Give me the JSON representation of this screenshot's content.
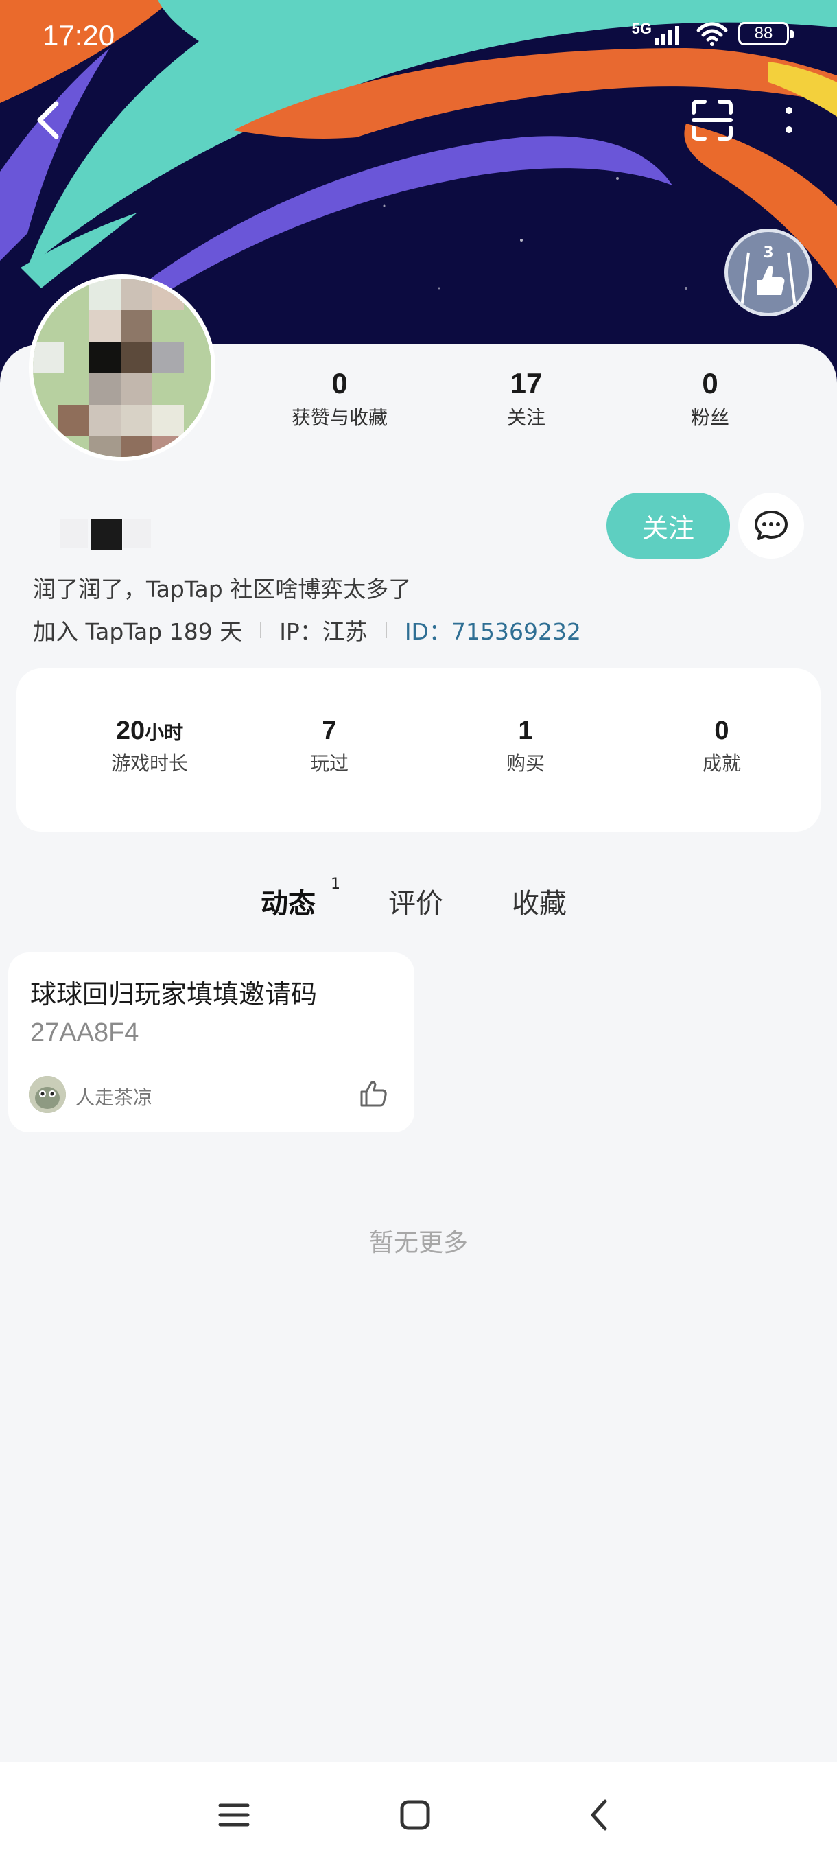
{
  "status_bar": {
    "time": "17:20",
    "network": "5G",
    "battery": "88"
  },
  "badge": {
    "level": "3"
  },
  "profile": {
    "bio": "润了润了，TapTap 社区啥博弈太多了",
    "join_text": "加入 TapTap 189 天",
    "ip_text": "IP：江苏",
    "id_text": "ID：715369232"
  },
  "top_stats": [
    {
      "value": "0",
      "label": "获赞与收藏"
    },
    {
      "value": "17",
      "label": "关注"
    },
    {
      "value": "0",
      "label": "粉丝"
    }
  ],
  "actions": {
    "follow_label": "关注"
  },
  "game_stats": [
    {
      "value": "20",
      "unit": "小时",
      "label": "游戏时长"
    },
    {
      "value": "7",
      "label": "玩过"
    },
    {
      "value": "1",
      "label": "购买"
    },
    {
      "value": "0",
      "label": "成就"
    }
  ],
  "tabs": [
    {
      "label": "动态",
      "count": "1"
    },
    {
      "label": "评价"
    },
    {
      "label": "收藏"
    }
  ],
  "posts": [
    {
      "title": "球球回归玩家填填邀请码",
      "code": "27AA8F4",
      "author": "人走茶凉"
    }
  ],
  "footer": {
    "no_more": "暂无更多"
  },
  "colors": {
    "accent": "#5ecfc1",
    "id_link": "#2f6f94",
    "banner_bg": "#0c0b40"
  }
}
